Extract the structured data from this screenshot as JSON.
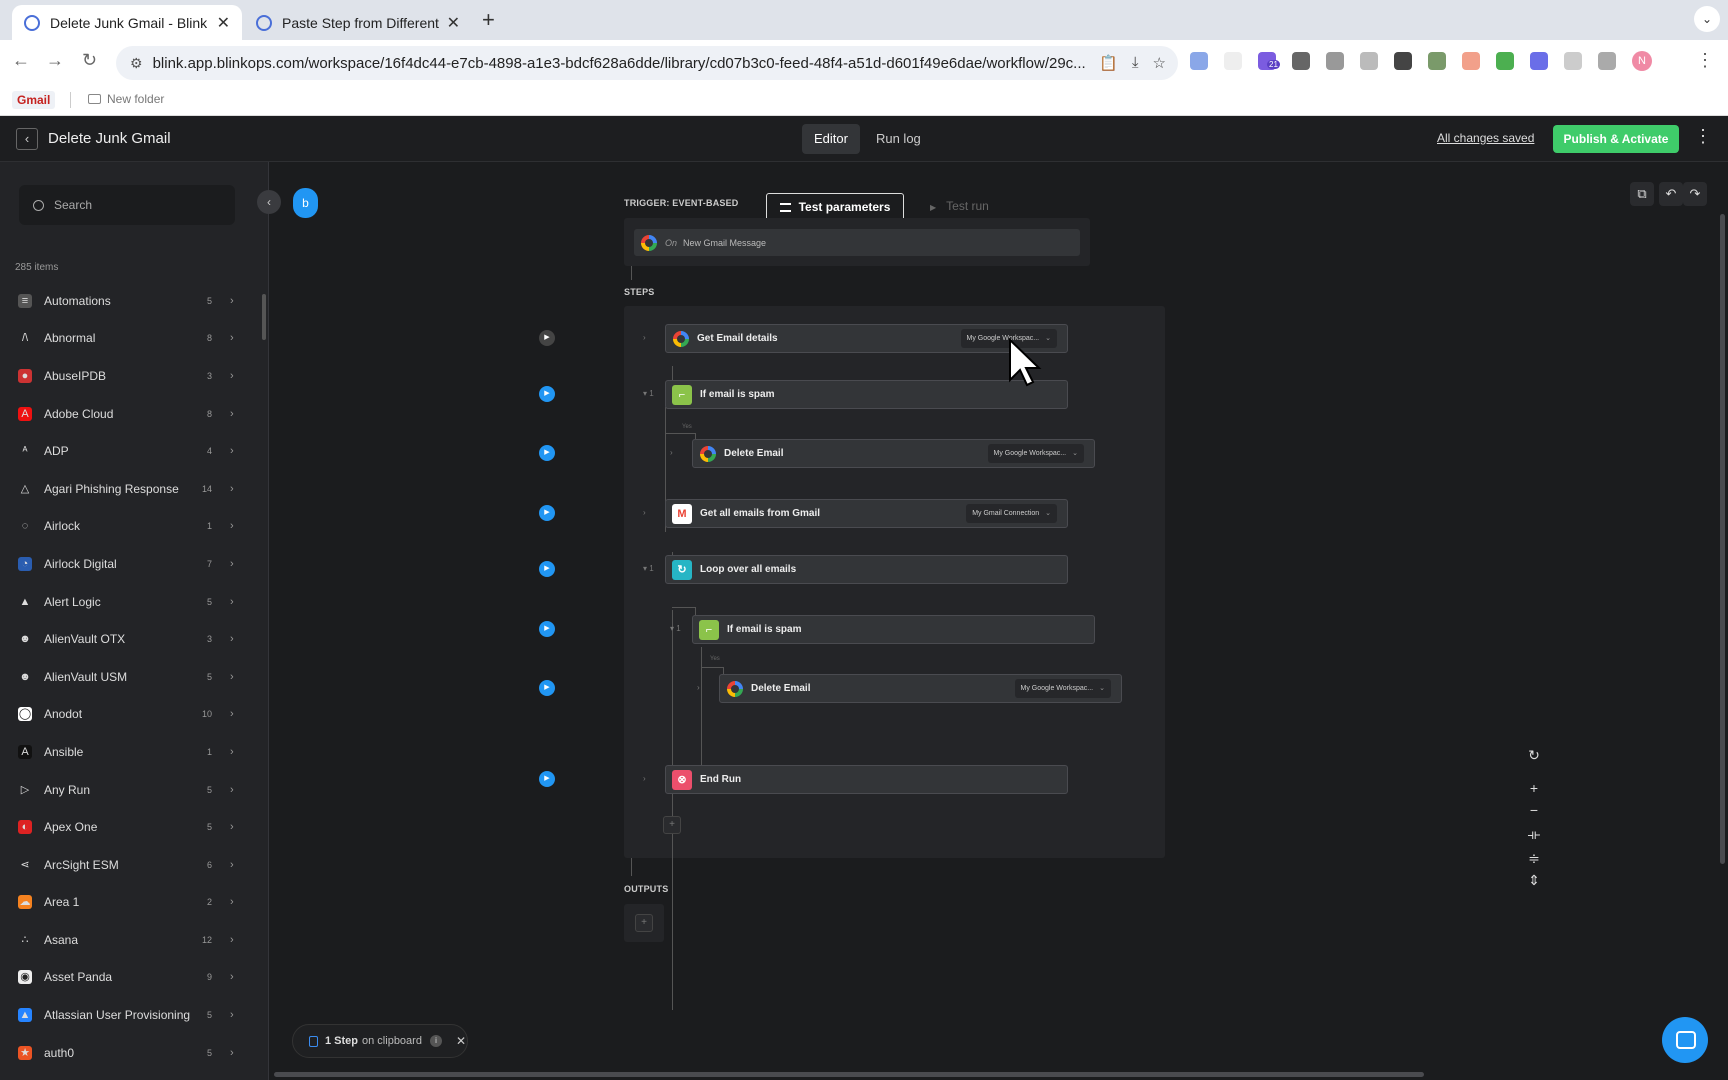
{
  "browser": {
    "tabs": [
      {
        "title": "Delete Junk Gmail - Blink",
        "active": true
      },
      {
        "title": "Paste Step from Different Bro",
        "active": false
      }
    ],
    "url": "blink.app.blinkops.com/workspace/16f4dc44-e7cb-4898-a1e3-bdcf628a6dde/library/cd07b3c0-feed-48f4-a51d-d601f49e6dae/workflow/29c...",
    "profile_initial": "N",
    "extension_badge": "21",
    "bookmarks": [
      {
        "label": "Gmail"
      },
      {
        "label": "New folder"
      }
    ]
  },
  "appbar": {
    "workflow_title": "Delete Junk Gmail",
    "tabs": [
      "Editor",
      "Run log"
    ],
    "active_tab": "Editor",
    "save_status": "All changes saved",
    "publish_label": "Publish & Activate",
    "accent": "#3fcc6a"
  },
  "sidebar": {
    "search_placeholder": "Search",
    "count_label": "285 items",
    "items": [
      {
        "name": "Automations",
        "count": "5",
        "icon": "automations-icon"
      },
      {
        "name": "Abnormal",
        "count": "8",
        "icon": "abnormal-icon"
      },
      {
        "name": "AbuseIPDB",
        "count": "3",
        "icon": "abuseipdb-icon"
      },
      {
        "name": "Adobe Cloud",
        "count": "8",
        "icon": "adobe-icon"
      },
      {
        "name": "ADP",
        "count": "4",
        "icon": "adp-icon"
      },
      {
        "name": "Agari Phishing Response",
        "count": "14",
        "icon": "agari-icon"
      },
      {
        "name": "Airlock",
        "count": "1",
        "icon": "airlock-icon"
      },
      {
        "name": "Airlock Digital",
        "count": "7",
        "icon": "airlock-digital-icon"
      },
      {
        "name": "Alert Logic",
        "count": "5",
        "icon": "alert-logic-icon"
      },
      {
        "name": "AlienVault OTX",
        "count": "3",
        "icon": "alienvault-icon"
      },
      {
        "name": "AlienVault USM",
        "count": "5",
        "icon": "alienvault-icon"
      },
      {
        "name": "Anodot",
        "count": "10",
        "icon": "anodot-icon"
      },
      {
        "name": "Ansible",
        "count": "1",
        "icon": "ansible-icon"
      },
      {
        "name": "Any Run",
        "count": "5",
        "icon": "anyrun-icon"
      },
      {
        "name": "Apex One",
        "count": "5",
        "icon": "apex-one-icon"
      },
      {
        "name": "ArcSight ESM",
        "count": "6",
        "icon": "arcsight-icon"
      },
      {
        "name": "Area 1",
        "count": "2",
        "icon": "area1-icon"
      },
      {
        "name": "Asana",
        "count": "12",
        "icon": "asana-icon"
      },
      {
        "name": "Asset Panda",
        "count": "9",
        "icon": "asset-panda-icon"
      },
      {
        "name": "Atlassian User Provisioning",
        "count": "5",
        "icon": "atlassian-icon"
      },
      {
        "name": "auth0",
        "count": "5",
        "icon": "auth0-icon"
      }
    ]
  },
  "canvas": {
    "test_parameters_label": "Test parameters",
    "test_run_label": "Test run",
    "trigger_label": "TRIGGER: EVENT-BASED",
    "trigger": {
      "prefix": "On",
      "event": "New Gmail Message"
    },
    "steps_label": "STEPS",
    "outputs_label": "OUTPUTS",
    "branch_yes": "Yes",
    "steps": [
      {
        "name": "Get Email details",
        "icon": "google-icon",
        "connection": "My Google Workspac...",
        "expander": "›"
      },
      {
        "name": "If email is spam",
        "icon": "condition-icon",
        "connection": "",
        "expander": "▾ 1"
      },
      {
        "name": "Delete Email",
        "icon": "google-icon",
        "connection": "My Google Workspac...",
        "expander": "›"
      },
      {
        "name": "Get all emails from Gmail",
        "icon": "gmail-icon",
        "connection": "My Gmail Connection",
        "expander": "›"
      },
      {
        "name": "Loop over all emails",
        "icon": "loop-icon",
        "connection": "",
        "expander": "▾ 1"
      },
      {
        "name": "If email is spam",
        "icon": "condition-icon",
        "connection": "",
        "expander": "▾ 1"
      },
      {
        "name": "Delete Email",
        "icon": "google-icon",
        "connection": "My Google Workspac...",
        "expander": "›"
      },
      {
        "name": "End Run",
        "icon": "end-run-icon",
        "connection": "",
        "expander": "›"
      }
    ],
    "clipboard": {
      "count": "1 Step",
      "suffix": "on clipboard"
    }
  }
}
